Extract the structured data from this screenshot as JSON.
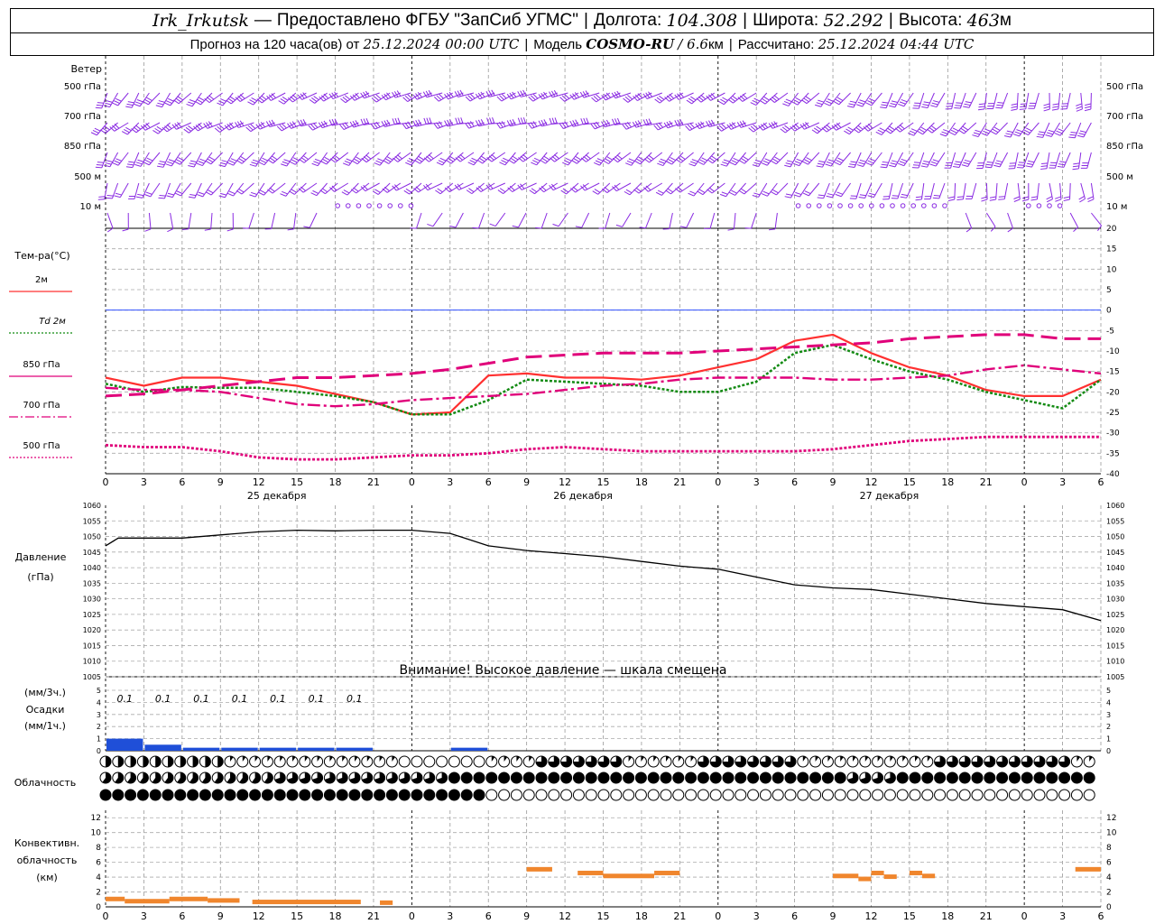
{
  "header": {
    "station": "Irk_Irkutsk",
    "dash": "—",
    "provider": "Предоставлено ФГБУ \"ЗапСиб УГМС\"",
    "lon_label": "Долгота:",
    "lon": "104.308",
    "lat_label": "Широта:",
    "lat": "52.292",
    "alt_label": "Высота:",
    "alt": "463",
    "alt_unit": "м",
    "forecast_label": "Прогноз на 120 часа(ов) от",
    "forecast_from": "25.12.2024 00:00 UTC",
    "model_label": "Модель",
    "model": "COSMO-RU",
    "model_res": "/ 6.6",
    "model_res_unit": "км",
    "computed_label": "Рассчитано:",
    "computed": "25.12.2024 04:44 UTC"
  },
  "wind_panel": {
    "title": "Ветер",
    "levels": [
      "500 гПа",
      "700 гПа",
      "850 гПа",
      "500 м",
      "10 м"
    ]
  },
  "temp_panel": {
    "title": "Тем-ра(°C)",
    "legend": [
      {
        "label": "2м",
        "color": "#ff3030",
        "style": "solid"
      },
      {
        "label": "Td 2м",
        "color": "#128a12",
        "style": "dotted"
      },
      {
        "label": "850 гПа",
        "color": "#e0007a",
        "style": "solid"
      },
      {
        "label": "700 гПа",
        "color": "#e0007a",
        "style": "dashdot"
      },
      {
        "label": "500 гПа",
        "color": "#e0007a",
        "style": "dotted"
      }
    ],
    "yticks": [
      "20",
      "15",
      "10",
      "5",
      "0",
      "-5",
      "-10",
      "-15",
      "-20",
      "-25",
      "-30",
      "-35",
      "-40"
    ]
  },
  "time_axis": {
    "hours": [
      "0",
      "3",
      "6",
      "9",
      "12",
      "15",
      "18",
      "21",
      "0",
      "3",
      "6",
      "9",
      "12",
      "15",
      "18",
      "21",
      "0",
      "3",
      "6",
      "9",
      "12",
      "15",
      "18",
      "21",
      "0",
      "3",
      "6"
    ],
    "dates": [
      "25 декабря",
      "26 декабря",
      "27 декабря"
    ]
  },
  "pressure_panel": {
    "title": "Давление",
    "unit": "(гПа)",
    "yticks": [
      "1060",
      "1055",
      "1050",
      "1045",
      "1040",
      "1035",
      "1030",
      "1025",
      "1020",
      "1015",
      "1010",
      "1005"
    ],
    "warning": "Внимание! Высокое давление — шкала смещена"
  },
  "precip_panel": {
    "unit_top": "(мм/3ч.)",
    "title": "Осадки",
    "unit_bottom": "(мм/1ч.)",
    "yticks": [
      "5",
      "4",
      "3",
      "2",
      "1",
      "0"
    ],
    "labels": [
      "0.1",
      "0.1",
      "0.1",
      "0.1",
      "0.1",
      "0.1",
      "0.1"
    ]
  },
  "cloud_panel": {
    "title": "Облачность"
  },
  "convective_panel": {
    "title_lines": [
      "Конвективн.",
      "облачность",
      "(км)"
    ],
    "yticks": [
      "12",
      "10",
      "8",
      "6",
      "4",
      "2",
      "0"
    ]
  },
  "colors": {
    "wind": "#8a2be2",
    "t2m": "#ff3030",
    "td": "#128a12",
    "p850": "#e0007a",
    "pressure": "#000000",
    "precip": "#1f4fd8",
    "convective": "#f0862d",
    "zero_line": "#3050ff"
  },
  "chart_data": [
    {
      "type": "line",
      "title": "Тем-ра(°C)",
      "x_hours": [
        0,
        3,
        6,
        9,
        12,
        15,
        18,
        21,
        24,
        27,
        30,
        33,
        36,
        39,
        42,
        45,
        48,
        51,
        54,
        57,
        60,
        63,
        66,
        69,
        72,
        75,
        78
      ],
      "ylim": [
        -40,
        20
      ],
      "series": [
        {
          "name": "2м",
          "values": [
            -16.5,
            -18.5,
            -16.5,
            -16.5,
            -17.5,
            -18.5,
            -20.5,
            -22.5,
            -25.5,
            -25,
            -16,
            -15.5,
            -16.5,
            -16.5,
            -17,
            -16,
            -14,
            -12,
            -7.5,
            -6,
            -10.5,
            -14,
            -16,
            -19.5,
            -21,
            -21,
            -17
          ]
        },
        {
          "name": "Td 2м",
          "values": [
            -18,
            -20,
            -18.8,
            -19,
            -19,
            -20,
            -21,
            -22.5,
            -25.5,
            -25.5,
            -22,
            -17,
            -17.5,
            -18,
            -18.5,
            -20,
            -20,
            -17.5,
            -10.5,
            -8.5,
            -12,
            -15,
            -17,
            -20,
            -22,
            -24,
            -17
          ]
        },
        {
          "name": "850 гПа",
          "values": [
            -21,
            -20.5,
            -19.5,
            -18.5,
            -17.5,
            -16.5,
            -16.5,
            -16,
            -15.5,
            -14.5,
            -13,
            -11.5,
            -11,
            -10.5,
            -10.5,
            -10.5,
            -10,
            -9.5,
            -9,
            -8.5,
            -8,
            -7,
            -6.5,
            -6,
            -6,
            -7,
            -7
          ]
        },
        {
          "name": "700 гПа",
          "values": [
            -19,
            -19.5,
            -19.5,
            -20,
            -21.5,
            -23,
            -23.5,
            -23,
            -22,
            -21.5,
            -21,
            -20.5,
            -19.5,
            -18.5,
            -18,
            -17,
            -16.5,
            -16.5,
            -16.5,
            -17,
            -17,
            -16.5,
            -16,
            -14.5,
            -13.5,
            -14.5,
            -15.5
          ]
        },
        {
          "name": "500 гПа",
          "values": [
            -33,
            -33.5,
            -33.5,
            -34.5,
            -36,
            -36.5,
            -36.5,
            -36,
            -35.5,
            -35.5,
            -35,
            -34,
            -33.5,
            -34,
            -34.5,
            -34.5,
            -34.5,
            -34.5,
            -34.5,
            -34,
            -33,
            -32,
            -31.5,
            -31,
            -31,
            -31,
            -31
          ]
        }
      ]
    },
    {
      "type": "line",
      "title": "Давление",
      "x_hours": [
        0,
        1,
        2,
        6,
        9,
        12,
        15,
        18,
        21,
        24,
        27,
        30,
        33,
        36,
        39,
        42,
        45,
        48,
        51,
        54,
        57,
        60,
        63,
        66,
        69,
        72,
        75,
        78
      ],
      "ylim": [
        1005,
        1060
      ],
      "series": [
        {
          "name": "Давление",
          "values": [
            1047,
            1049.5,
            1049.5,
            1049.5,
            1050.5,
            1051.5,
            1052,
            1051.8,
            1052,
            1052,
            1051,
            1047,
            1045.5,
            1044.5,
            1043.5,
            1042,
            1040.5,
            1039.5,
            1037,
            1034.5,
            1033.5,
            1033,
            1031.5,
            1030,
            1028.5,
            1027.5,
            1026.5,
            1023
          ]
        }
      ]
    },
    {
      "type": "bar",
      "title": "Осадки",
      "x_hours": [
        0,
        3,
        6,
        9,
        12,
        15,
        18,
        21,
        24,
        27
      ],
      "ylim": [
        0,
        5
      ],
      "series": [
        {
          "name": "мм/1ч",
          "values": [
            0.2,
            0.1,
            0.05,
            0.05,
            0.05,
            0.05,
            0.05,
            0,
            0,
            0.05
          ]
        }
      ]
    },
    {
      "type": "bar",
      "title": "Конвективн. облачность (км)",
      "ylim": [
        0,
        12
      ],
      "segments": [
        {
          "x0": 0,
          "x1": 1.5,
          "top": 1.0
        },
        {
          "x0": 1.5,
          "x1": 5,
          "top": 0.7
        },
        {
          "x0": 5,
          "x1": 8,
          "top": 1.0
        },
        {
          "x0": 8,
          "x1": 10.5,
          "top": 0.8
        },
        {
          "x0": 11.5,
          "x1": 20,
          "top": 0.6
        },
        {
          "x0": 21.5,
          "x1": 22.5,
          "top": 0.5
        },
        {
          "x0": 33,
          "x1": 35,
          "top": 5.0
        },
        {
          "x0": 37,
          "x1": 39,
          "top": 4.5
        },
        {
          "x0": 39,
          "x1": 43,
          "top": 4.1
        },
        {
          "x0": 43,
          "x1": 45,
          "top": 4.5
        },
        {
          "x0": 57,
          "x1": 59,
          "top": 4.1
        },
        {
          "x0": 59,
          "x1": 60,
          "top": 3.7
        },
        {
          "x0": 60,
          "x1": 61,
          "top": 4.5
        },
        {
          "x0": 61,
          "x1": 62,
          "top": 4.0
        },
        {
          "x0": 63,
          "x1": 64,
          "top": 4.5
        },
        {
          "x0": 64,
          "x1": 65,
          "top": 4.1
        },
        {
          "x0": 76,
          "x1": 78,
          "top": 5.0
        }
      ]
    }
  ]
}
